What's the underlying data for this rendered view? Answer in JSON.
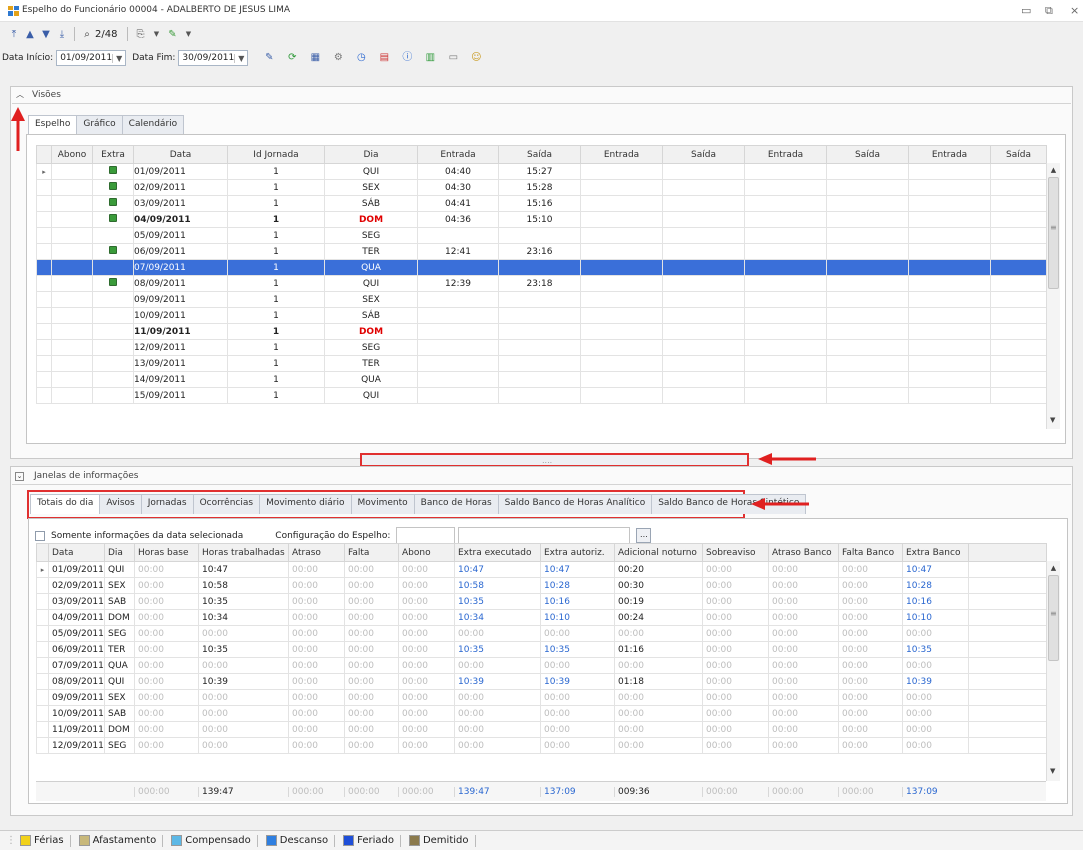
{
  "window": {
    "title": "Espelho do Funcionário 00004 - ADALBERTO DE JESUS LIMA"
  },
  "toolbar": {
    "record_counter": "2/48",
    "data_inicio_label": "Data Início:",
    "data_inicio_value": "01/09/2011",
    "data_fim_label": "Data Fim:",
    "data_fim_value": "30/09/2011"
  },
  "visoes": {
    "title": "Visões",
    "tabs": [
      {
        "label": "Espelho",
        "active": true
      },
      {
        "label": "Gráfico",
        "active": false
      },
      {
        "label": "Calendário",
        "active": false
      }
    ],
    "columns": [
      "Abono",
      "Extra",
      "Data",
      "Id Jornada",
      "Dia",
      "Entrada",
      "Saída",
      "Entrada",
      "Saída",
      "Entrada",
      "Saída",
      "Entrada",
      "Saída"
    ],
    "rows": [
      {
        "extra": true,
        "data": "01/09/2011",
        "jornada": "1",
        "dia": "QUI",
        "e1": "04:40",
        "s1": "15:27",
        "style": "normal"
      },
      {
        "extra": true,
        "data": "02/09/2011",
        "jornada": "1",
        "dia": "SEX",
        "e1": "04:30",
        "s1": "15:28",
        "style": "normal"
      },
      {
        "extra": true,
        "data": "03/09/2011",
        "jornada": "1",
        "dia": "SÁB",
        "e1": "04:41",
        "s1": "15:16",
        "style": "normal"
      },
      {
        "extra": true,
        "data": "04/09/2011",
        "jornada": "1",
        "dia": "DOM",
        "e1": "04:36",
        "s1": "15:10",
        "style": "bold"
      },
      {
        "extra": false,
        "data": "05/09/2011",
        "jornada": "1",
        "dia": "SEG",
        "e1": "",
        "s1": "",
        "style": "normal"
      },
      {
        "extra": true,
        "data": "06/09/2011",
        "jornada": "1",
        "dia": "TER",
        "e1": "12:41",
        "s1": "23:16",
        "style": "normal"
      },
      {
        "extra": false,
        "data": "07/09/2011",
        "jornada": "1",
        "dia": "QUA",
        "e1": "",
        "s1": "",
        "style": "selected"
      },
      {
        "extra": true,
        "data": "08/09/2011",
        "jornada": "1",
        "dia": "QUI",
        "e1": "12:39",
        "s1": "23:18",
        "style": "normal"
      },
      {
        "extra": false,
        "data": "09/09/2011",
        "jornada": "1",
        "dia": "SEX",
        "e1": "",
        "s1": "",
        "style": "normal"
      },
      {
        "extra": false,
        "data": "10/09/2011",
        "jornada": "1",
        "dia": "SÁB",
        "e1": "",
        "s1": "",
        "style": "normal"
      },
      {
        "extra": false,
        "data": "11/09/2011",
        "jornada": "1",
        "dia": "DOM",
        "e1": "",
        "s1": "",
        "style": "bold"
      },
      {
        "extra": false,
        "data": "12/09/2011",
        "jornada": "1",
        "dia": "SEG",
        "e1": "",
        "s1": "",
        "style": "normal"
      },
      {
        "extra": false,
        "data": "13/09/2011",
        "jornada": "1",
        "dia": "TER",
        "e1": "",
        "s1": "",
        "style": "normal"
      },
      {
        "extra": false,
        "data": "14/09/2011",
        "jornada": "1",
        "dia": "QUA",
        "e1": "",
        "s1": "",
        "style": "normal"
      },
      {
        "extra": false,
        "data": "15/09/2011",
        "jornada": "1",
        "dia": "QUI",
        "e1": "",
        "s1": "",
        "style": "normal"
      }
    ]
  },
  "splitter_dots": "....",
  "janelas": {
    "title": "Janelas de informações",
    "tabs": [
      {
        "label": "Totais do dia",
        "active": true
      },
      {
        "label": "Avisos",
        "active": false
      },
      {
        "label": "Jornadas",
        "active": false
      },
      {
        "label": "Ocorrências",
        "active": false
      },
      {
        "label": "Movimento diário",
        "active": false
      },
      {
        "label": "Movimento",
        "active": false
      },
      {
        "label": "Banco de Horas",
        "active": false
      },
      {
        "label": "Saldo Banco de Horas Analítico",
        "active": false
      },
      {
        "label": "Saldo Banco de Horas Sintético",
        "active": false
      }
    ],
    "checkbox_label": "Somente informações da data selecionada",
    "config_label": "Configuração do Espelho:",
    "ellipsis": "...",
    "columns": [
      "Data",
      "Dia",
      "Horas base",
      "Horas trabalhadas",
      "Atraso",
      "Falta",
      "Abono",
      "Extra executado",
      "Extra autoriz.",
      "Adicional noturno",
      "Sobreaviso",
      "Atraso Banco",
      "Falta Banco",
      "Extra Banco"
    ],
    "rows": [
      [
        "01/09/2011",
        "QUI",
        "00:00",
        "10:47",
        "00:00",
        "00:00",
        "00:00",
        "10:47",
        "10:47",
        "00:20",
        "00:00",
        "00:00",
        "00:00",
        "10:47"
      ],
      [
        "02/09/2011",
        "SEX",
        "00:00",
        "10:58",
        "00:00",
        "00:00",
        "00:00",
        "10:58",
        "10:28",
        "00:30",
        "00:00",
        "00:00",
        "00:00",
        "10:28"
      ],
      [
        "03/09/2011",
        "SAB",
        "00:00",
        "10:35",
        "00:00",
        "00:00",
        "00:00",
        "10:35",
        "10:16",
        "00:19",
        "00:00",
        "00:00",
        "00:00",
        "10:16"
      ],
      [
        "04/09/2011",
        "DOM",
        "00:00",
        "10:34",
        "00:00",
        "00:00",
        "00:00",
        "10:34",
        "10:10",
        "00:24",
        "00:00",
        "00:00",
        "00:00",
        "10:10"
      ],
      [
        "05/09/2011",
        "SEG",
        "00:00",
        "00:00",
        "00:00",
        "00:00",
        "00:00",
        "00:00",
        "00:00",
        "00:00",
        "00:00",
        "00:00",
        "00:00",
        "00:00"
      ],
      [
        "06/09/2011",
        "TER",
        "00:00",
        "10:35",
        "00:00",
        "00:00",
        "00:00",
        "10:35",
        "10:35",
        "01:16",
        "00:00",
        "00:00",
        "00:00",
        "10:35"
      ],
      [
        "07/09/2011",
        "QUA",
        "00:00",
        "00:00",
        "00:00",
        "00:00",
        "00:00",
        "00:00",
        "00:00",
        "00:00",
        "00:00",
        "00:00",
        "00:00",
        "00:00"
      ],
      [
        "08/09/2011",
        "QUI",
        "00:00",
        "10:39",
        "00:00",
        "00:00",
        "00:00",
        "10:39",
        "10:39",
        "01:18",
        "00:00",
        "00:00",
        "00:00",
        "10:39"
      ],
      [
        "09/09/2011",
        "SEX",
        "00:00",
        "00:00",
        "00:00",
        "00:00",
        "00:00",
        "00:00",
        "00:00",
        "00:00",
        "00:00",
        "00:00",
        "00:00",
        "00:00"
      ],
      [
        "10/09/2011",
        "SAB",
        "00:00",
        "00:00",
        "00:00",
        "00:00",
        "00:00",
        "00:00",
        "00:00",
        "00:00",
        "00:00",
        "00:00",
        "00:00",
        "00:00"
      ],
      [
        "11/09/2011",
        "DOM",
        "00:00",
        "00:00",
        "00:00",
        "00:00",
        "00:00",
        "00:00",
        "00:00",
        "00:00",
        "00:00",
        "00:00",
        "00:00",
        "00:00"
      ],
      [
        "12/09/2011",
        "SEG",
        "00:00",
        "00:00",
        "00:00",
        "00:00",
        "00:00",
        "00:00",
        "00:00",
        "00:00",
        "00:00",
        "00:00",
        "00:00",
        "00:00"
      ]
    ],
    "totals": [
      "",
      "",
      "000:00",
      "139:47",
      "000:00",
      "000:00",
      "000:00",
      "139:47",
      "137:09",
      "009:36",
      "000:00",
      "000:00",
      "000:00",
      "137:09"
    ]
  },
  "legend": [
    {
      "label": "Férias",
      "color": "#f2d21a"
    },
    {
      "label": "Afastamento",
      "color": "#c8b87a"
    },
    {
      "label": "Compensado",
      "color": "#5cb8e6"
    },
    {
      "label": "Descanso",
      "color": "#2f7fe0"
    },
    {
      "label": "Feriado",
      "color": "#1f4fd8"
    },
    {
      "label": "Demitido",
      "color": "#8b7a4c"
    }
  ],
  "colors": {
    "selection": "#3a6fd9",
    "highlight_box": "#e03030",
    "weekend_red": "#e00000",
    "value_blue": "#2a67d0"
  }
}
